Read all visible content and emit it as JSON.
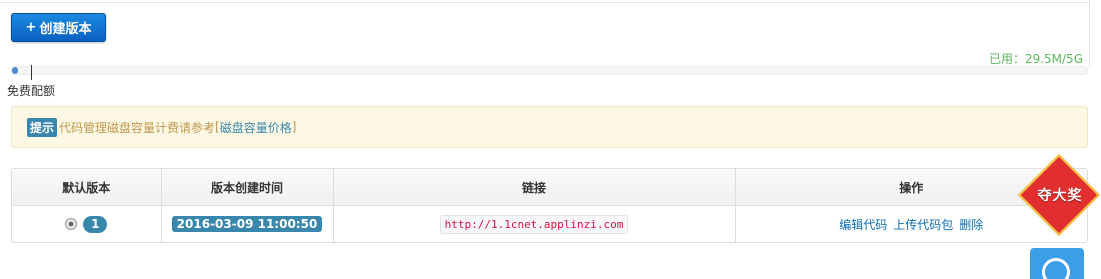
{
  "toolbar": {
    "create_plus": "+",
    "create_label": "创建版本"
  },
  "usage": {
    "text": "已用：29.5M/5G",
    "percent": 0.6
  },
  "quota": {
    "free_label": "免费配额"
  },
  "notice": {
    "badge": "提示",
    "text": "代码管理磁盘容量计费请参考",
    "bracket_open": "[",
    "link": "磁盘容量价格",
    "bracket_close": "]"
  },
  "table": {
    "headers": [
      "默认版本",
      "版本创建时间",
      "链接",
      "操作"
    ],
    "rows": [
      {
        "version": "1",
        "created": "2016-03-09 11:00:50",
        "url": "http://1.1cnet.applinzi.com",
        "actions": [
          "编辑代码",
          "上传代码包",
          "删除"
        ]
      }
    ]
  },
  "promo": {
    "label": "夺大奖"
  },
  "icons": {
    "plus": "plus-icon",
    "radio": "radio-icon",
    "support": "headset-icon"
  },
  "colors": {
    "primary": "#0a6fd0",
    "info": "#3a87ad",
    "success": "#5cb85c",
    "warning_bg": "#fcf8e3",
    "promo_red": "#e12e2e"
  }
}
